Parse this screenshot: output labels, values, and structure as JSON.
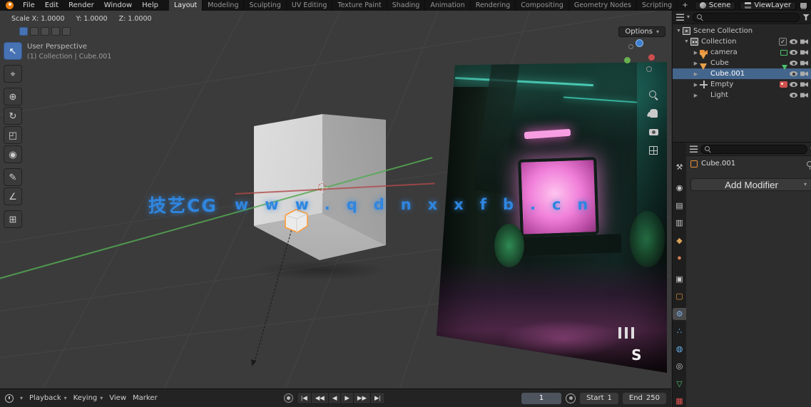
{
  "colors": {
    "accent": "#4772b3",
    "selection_row": "#44658c",
    "axis_green": "#55a954",
    "axis_red": "#b04a4a",
    "watermark": "#2f86e0",
    "selection_outline": "#ff9a33",
    "active_tab_icon": "#7ab0e8"
  },
  "topbar": {
    "menus": [
      "File",
      "Edit",
      "Render",
      "Window",
      "Help"
    ],
    "workspaces": [
      "Layout",
      "Modeling",
      "Sculpting",
      "UV Editing",
      "Texture Paint",
      "Shading",
      "Animation",
      "Rendering",
      "Compositing",
      "Geometry Nodes",
      "Scripting"
    ],
    "add_workspace_label": "+",
    "active_workspace": "Layout",
    "scene_label": "Scene",
    "viewlayer_label": "ViewLayer"
  },
  "operator_status": {
    "scale_x": "Scale X: 1.0000",
    "scale_y": "Y: 1.0000",
    "scale_z": "Z: 1.0000"
  },
  "viewport": {
    "options_button": "Options",
    "view_label": "User Perspective",
    "context_label": "(1) Collection | Cube.001",
    "watermark_cjk": "技艺CG",
    "watermark_url": "www.qdnxxfb.cn",
    "image_mark": "S"
  },
  "tools": [
    {
      "name": "select-box",
      "glyph": "↖"
    },
    {
      "name": "cursor",
      "glyph": "⌖"
    },
    {
      "name": "move",
      "glyph": "⊕"
    },
    {
      "name": "rotate",
      "glyph": "↻"
    },
    {
      "name": "scale",
      "glyph": "◰"
    },
    {
      "name": "transform",
      "glyph": "◉"
    },
    {
      "name": "annotate",
      "glyph": "✎"
    },
    {
      "name": "measure",
      "glyph": "∠"
    },
    {
      "name": "add-cube",
      "glyph": "⊞"
    }
  ],
  "outliner": {
    "rows": [
      {
        "label": "Scene Collection",
        "icon": "scene-collection-icon"
      },
      {
        "label": "Collection",
        "icon": "collection-icon"
      },
      {
        "label": "camera",
        "icon": "camera-icon"
      },
      {
        "label": "Cube",
        "icon": "mesh-icon"
      },
      {
        "label": "Cube.001",
        "icon": "mesh-icon"
      },
      {
        "label": "Empty",
        "icon": "empty-icon"
      },
      {
        "label": "Light",
        "icon": "light-icon"
      }
    ]
  },
  "properties": {
    "object_name": "Cube.001",
    "add_modifier_label": "Add Modifier",
    "tabs": [
      {
        "name": "tool",
        "glyph": "⚒",
        "color": "#c9c9c9"
      },
      {
        "name": "render",
        "glyph": "◉",
        "color": "#c9c9c9"
      },
      {
        "name": "output",
        "glyph": "▤",
        "color": "#c9c9c9"
      },
      {
        "name": "view-layer",
        "glyph": "▥",
        "color": "#c9c9c9"
      },
      {
        "name": "scene",
        "glyph": "◆",
        "color": "#d7a35a"
      },
      {
        "name": "world",
        "glyph": "●",
        "color": "#cf7d52"
      },
      {
        "name": "collection",
        "glyph": "▣",
        "color": "#c9c9c9"
      },
      {
        "name": "object",
        "glyph": "▢",
        "color": "#e8923d"
      },
      {
        "name": "modifiers",
        "glyph": "⚙",
        "color": "#7ab0e8"
      },
      {
        "name": "particles",
        "glyph": "∴",
        "color": "#6bb3f0"
      },
      {
        "name": "physics",
        "glyph": "◍",
        "color": "#6bb3f0"
      },
      {
        "name": "constraints",
        "glyph": "◎",
        "color": "#c9c9c9"
      },
      {
        "name": "object-data",
        "glyph": "▽",
        "color": "#49c26e"
      },
      {
        "name": "texture",
        "glyph": "▦",
        "color": "#e05252"
      }
    ]
  },
  "timeline": {
    "menus": [
      "Playback",
      "Keying",
      "View",
      "Marker"
    ],
    "transport": [
      "|◀",
      "◀◀",
      "◀",
      "▶",
      "▶▶",
      "▶|"
    ],
    "current_frame": "1",
    "start_label": "Start",
    "start_value": "1",
    "end_label": "End",
    "end_value": "250"
  }
}
